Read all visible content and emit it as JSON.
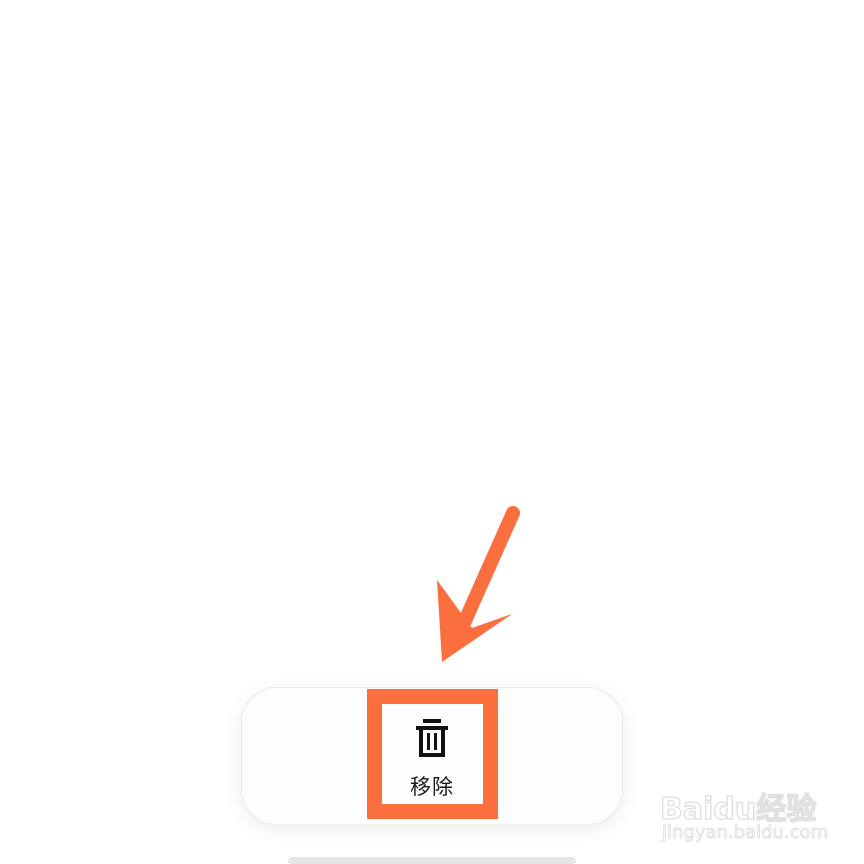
{
  "actions": {
    "remove_label": "移除",
    "remove_icon": "trash-icon"
  },
  "annotation": {
    "highlight_color": "#fb6e3e",
    "arrow_color": "#fb6e3e"
  },
  "watermark": {
    "logo_text": "Baidu经验",
    "url_text": "jingyan.baidu.com"
  }
}
